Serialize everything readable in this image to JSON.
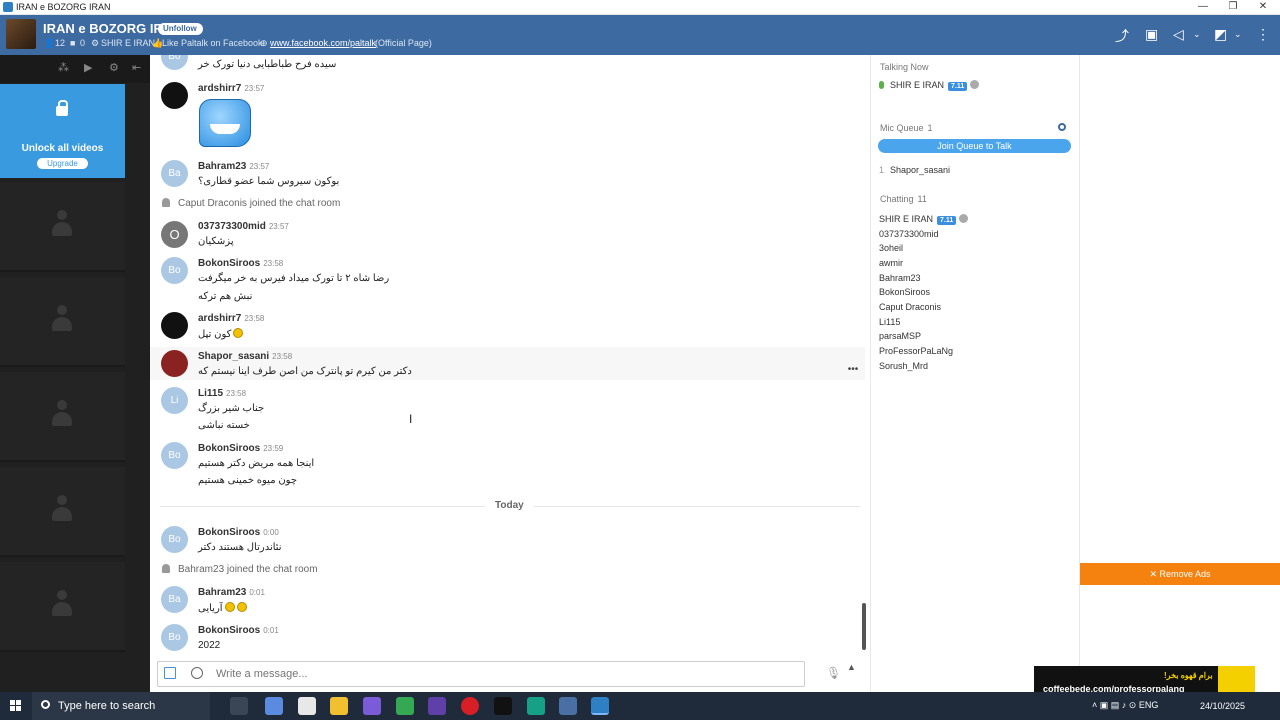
{
  "window": {
    "title": "IRAN e BOZORG IRAN",
    "controls": [
      "—",
      "❐",
      "✕"
    ]
  },
  "header": {
    "room_title": "IRAN e BOZORG IRAN",
    "unfollow_label": "Unfollow",
    "members_count": "12",
    "cams_count": "0",
    "owner": "SHIR E IRAN",
    "promo_text": "Like Paltalk on Facebook:",
    "promo_link": "www.facebook.com/paltalk",
    "promo_suffix": "(Official Page)"
  },
  "left_panel": {
    "unlock_text": "Unlock all videos",
    "upgrade_label": "Upgrade"
  },
  "chat": {
    "messages": [
      {
        "text": "سیده فرح طباطبایی دنیا تورک خر"
      },
      {
        "user": "ardshirr7",
        "time": "23:57"
      },
      {
        "user": "Bahram23",
        "time": "23:57",
        "avatar": "Ba",
        "lines": [
          "بوکون سیروس شما عضو قطاری؟"
        ]
      },
      {
        "system": "Caput Draconis joined the chat room"
      },
      {
        "user": "037373300mid",
        "time": "23:57",
        "avatar": "O",
        "lines": [
          "پزشکیان"
        ]
      },
      {
        "user": "BokonSiroos",
        "time": "23:58",
        "avatar": "Bo",
        "lines": [
          "رضا شاه ۲ تا تورک میداد فیرس به خر میگرفت",
          "نبش هم ترکه"
        ]
      },
      {
        "user": "ardshirr7",
        "time": "23:58",
        "lines": [
          "کون تپل"
        ]
      },
      {
        "user": "Shapor_sasani",
        "time": "23:58",
        "lines": [
          "دکتر من کیرم تو پانترک من اصن طرف اینا نیستم که"
        ]
      },
      {
        "user": "Li115",
        "time": "23:58",
        "avatar": "Li",
        "lines": [
          "جناب شیر بزرگ",
          "خسته نباشی"
        ]
      },
      {
        "user": "BokonSiroos",
        "time": "23:59",
        "avatar": "Bo",
        "lines": [
          "اینجا همه مریض دکتر هستیم",
          "چون میوه خمینی هستیم"
        ]
      },
      {
        "user": "BokonSiroos",
        "time": "0:00",
        "avatar": "Bo",
        "lines": [
          "نئاندرتال هستند دکتر"
        ]
      },
      {
        "system": "Bahram23 joined the chat room"
      },
      {
        "user": "Bahram23",
        "time": "0:01",
        "avatar": "Ba",
        "lines": [
          "آریایی"
        ]
      },
      {
        "user": "BokonSiroos",
        "time": "0:01",
        "avatar": "Bo",
        "lines": [
          "2022"
        ]
      }
    ],
    "divider": "Today",
    "composer_placeholder": "Write a message..."
  },
  "users_panel": {
    "talking_now": "Talking Now",
    "talker": "SHIR E IRAN",
    "badge": "7.11",
    "mic_queue": "Mic Queue",
    "mic_queue_count": "1",
    "join_queue": "Join Queue to Talk",
    "queue": [
      {
        "num": "1",
        "name": "Shapor_sasani"
      }
    ],
    "chatting": "Chatting",
    "chatting_count": "11",
    "users": [
      "SHIR E IRAN",
      "037373300mid",
      "3oheil",
      "awmir",
      "Bahram23",
      "BokonSiroos",
      "Caput Draconis",
      "Li115",
      "parsaMSP",
      "ProFessorPaLaNg",
      "Sorush_Mrd"
    ]
  },
  "ads": {
    "remove_ads": "✕ Remove Ads",
    "banner_line1": "برام قهوه بخر!",
    "banner_line2": "coffeebede.com/professorpalang"
  },
  "taskbar": {
    "search_placeholder": "Type here to search",
    "lang": "ENG",
    "date": "24/10/2025"
  },
  "colors": {
    "header": "#3d6aa0",
    "accent": "#4ba5ec",
    "ads": "#f5820f"
  }
}
